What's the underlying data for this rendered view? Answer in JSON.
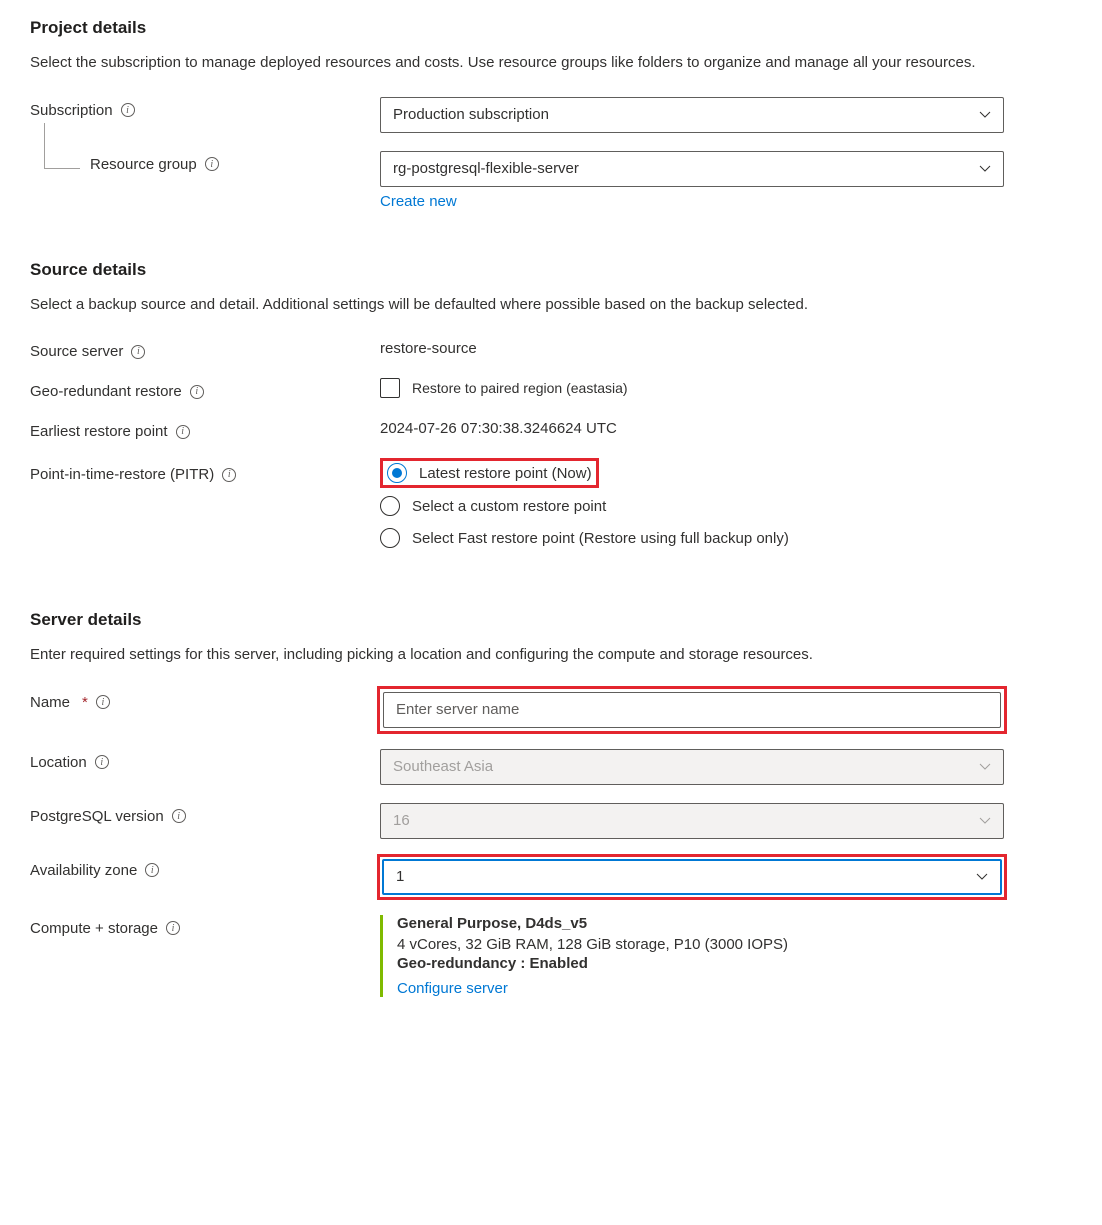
{
  "projectDetails": {
    "heading": "Project details",
    "description": "Select the subscription to manage deployed resources and costs. Use resource groups like folders to organize and manage all your resources.",
    "subscriptionLabel": "Subscription",
    "subscriptionValue": "Production subscription",
    "resourceGroupLabel": "Resource group",
    "resourceGroupValue": "rg-postgresql-flexible-server",
    "createNewLink": "Create new"
  },
  "sourceDetails": {
    "heading": "Source details",
    "description": "Select a backup source and detail. Additional settings will be defaulted where possible based on the backup selected.",
    "sourceServerLabel": "Source server",
    "sourceServerValue": "restore-source",
    "geoRestoreLabel": "Geo-redundant restore",
    "geoRestoreCheckboxLabel": "Restore to paired region (eastasia)",
    "earliestRestoreLabel": "Earliest restore point",
    "earliestRestoreValue": "2024-07-26 07:30:38.3246624 UTC",
    "pitrLabel": "Point-in-time-restore (PITR)",
    "pitrOptions": {
      "latest": "Latest restore point (Now)",
      "custom": "Select a custom restore point",
      "fast": "Select Fast restore point (Restore using full backup only)"
    },
    "pitrSelected": "latest"
  },
  "serverDetails": {
    "heading": "Server details",
    "description": "Enter required settings for this server, including picking a location and configuring the compute and storage resources.",
    "nameLabel": "Name",
    "namePlaceholder": "Enter server name",
    "nameValue": "",
    "locationLabel": "Location",
    "locationValue": "Southeast Asia",
    "pgVersionLabel": "PostgreSQL version",
    "pgVersionValue": "16",
    "azLabel": "Availability zone",
    "azValue": "1",
    "computeLabel": "Compute + storage",
    "computeTier": "General Purpose, D4ds_v5",
    "computeSpecs": "4 vCores, 32 GiB RAM, 128 GiB storage, P10 (3000 IOPS)",
    "computeGeo": "Geo-redundancy : Enabled",
    "configureLink": "Configure server"
  }
}
